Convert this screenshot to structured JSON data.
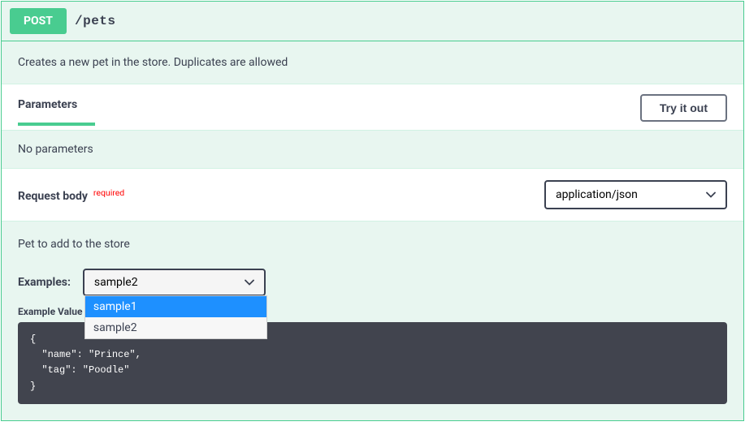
{
  "operation": {
    "method": "POST",
    "path": "/pets",
    "description": "Creates a new pet in the store. Duplicates are allowed"
  },
  "parameters": {
    "title": "Parameters",
    "try_it_out": "Try it out",
    "no_params": "No parameters"
  },
  "request_body": {
    "title": "Request body",
    "required": "required",
    "content_type": "application/json",
    "description": "Pet to add to the store",
    "examples_label": "Examples:",
    "selected_example": "sample2",
    "dropdown_options": [
      "sample1",
      "sample2"
    ],
    "highlighted_option_index": 0,
    "example_value_label": "Example Value",
    "example_code": "{\n  \"name\": \"Prince\",\n  \"tag\": \"Poodle\"\n}"
  }
}
